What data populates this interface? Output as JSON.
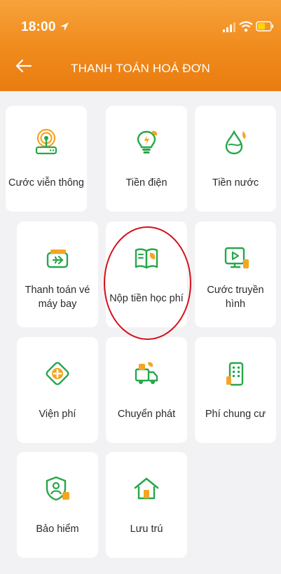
{
  "status": {
    "time": "18:00"
  },
  "header": {
    "title": "THANH TOÁN HOÁ ĐƠN"
  },
  "tiles": [
    {
      "label": "Cước viễn thông",
      "icon": "router-icon"
    },
    {
      "label": "Tiền điện",
      "icon": "lightbulb-icon"
    },
    {
      "label": "Tiền nước",
      "icon": "water-drop-icon"
    },
    {
      "label": "Thanh toán vé máy bay",
      "icon": "plane-ticket-icon"
    },
    {
      "label": "Nộp tiền học phí",
      "icon": "book-icon"
    },
    {
      "label": "Cước truyền hình",
      "icon": "tv-icon"
    },
    {
      "label": "Viện phí",
      "icon": "hospital-cross-icon"
    },
    {
      "label": "Chuyển phát",
      "icon": "delivery-truck-icon"
    },
    {
      "label": "Phí chung cư",
      "icon": "building-icon"
    },
    {
      "label": "Bảo hiểm",
      "icon": "insurance-shield-icon"
    },
    {
      "label": "Lưu trú",
      "icon": "house-icon"
    }
  ],
  "colors": {
    "header": "#f08a1c",
    "icon_green": "#27a74a",
    "accent_orange": "#f5a524",
    "highlight_ring": "#d4101b"
  }
}
